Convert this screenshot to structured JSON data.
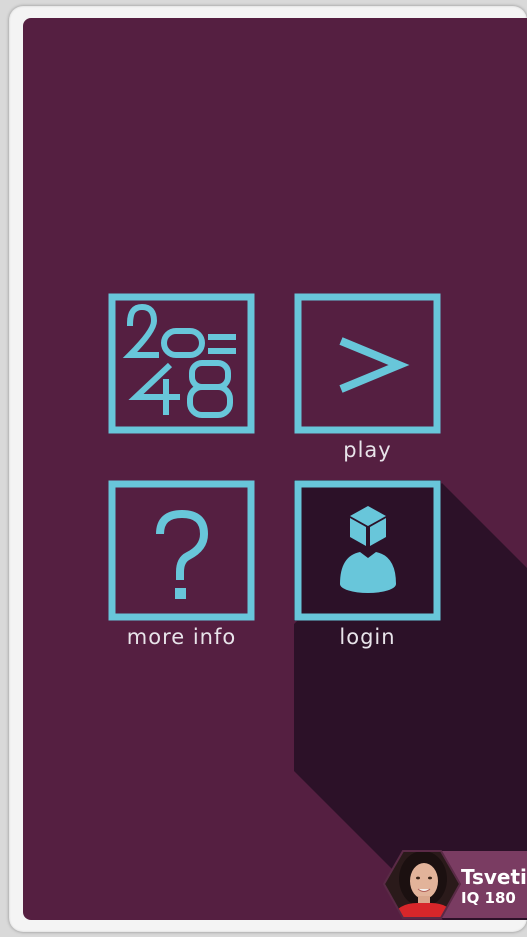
{
  "colors": {
    "background": "#551f41",
    "accent": "#68c6da",
    "text": "#e8e4ea",
    "long_shadow": "#2c1128",
    "profile_bg": "#7a3c62"
  },
  "menu": {
    "game_logo_icon": "2048-logo-icon",
    "play_icon": "chevron-right-icon",
    "play_label": "play",
    "info_icon": "question-mark-icon",
    "info_label": "more info",
    "login_icon": "user-cube-icon",
    "login_label": "login"
  },
  "profile": {
    "name": "Tsveti",
    "iq": "IQ 180"
  }
}
